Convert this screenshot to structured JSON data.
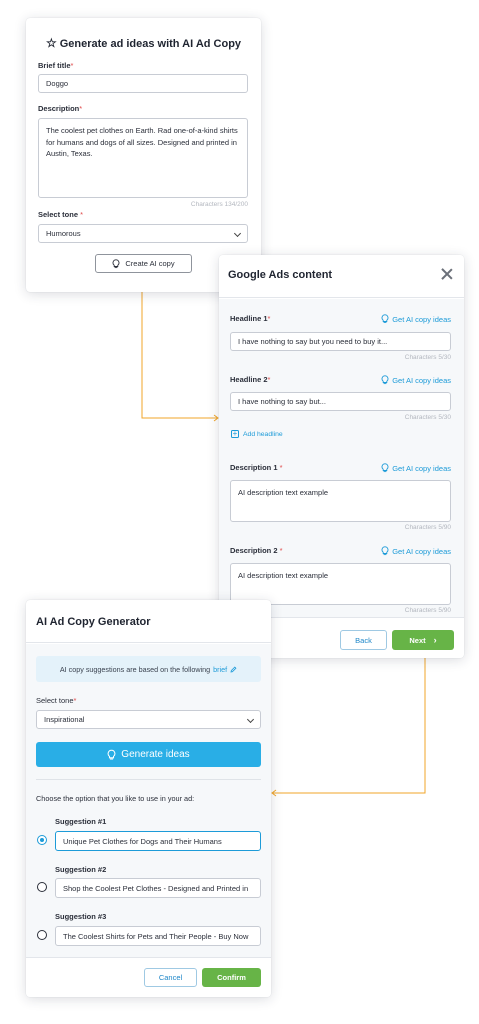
{
  "ad_brief": {
    "title": "Generate ad ideas with AI Ad Copy",
    "brief_title_label": "Brief title",
    "brief_title_value": "Doggo",
    "description_label": "Description",
    "description_value": "The coolest pet clothes on Earth. Rad one-of-a-kind shirts for humans and dogs of all sizes. Designed and printed in Austin, Texas.",
    "description_counter": "Characters 134/200",
    "tone_label": "Select tone",
    "tone_value": "Humorous",
    "create_button": "Create AI copy"
  },
  "google_ads": {
    "title": "Google Ads content",
    "ai_link": "Get AI copy ideas",
    "headline1_label": "Headline 1",
    "headline1_value": "I have nothing to say but you need to buy it...",
    "headline1_counter": "Characters 5/30",
    "headline2_label": "Headline 2",
    "headline2_value": "I have nothing to say but...",
    "headline2_counter": "Characters 5/30",
    "add_headline": "Add headline",
    "description1_label": "Description 1",
    "description1_value": "AI description text example",
    "description1_counter": "Characters 5/90",
    "description2_label": "Description 2",
    "description2_value": "AI description text example",
    "description2_counter": "Characters 5/90",
    "back_button": "Back",
    "next_button": "Next"
  },
  "generator": {
    "title": "AI Ad Copy Generator",
    "info_text": "AI copy suggestions are based on the following",
    "info_link": "brief",
    "tone_label": "Select tone",
    "tone_value": "Inspirational",
    "generate_button": "Generate ideas",
    "choose_text": "Choose the option that you like to use in your ad:",
    "suggestions": [
      {
        "label": "Suggestion #1",
        "value": "Unique Pet Clothes for Dogs and Their Humans",
        "selected": true
      },
      {
        "label": "Suggestion #2",
        "value": "Shop the Coolest Pet Clothes - Designed and Printed in",
        "selected": false
      },
      {
        "label": "Suggestion #3",
        "value": "The Coolest Shirts for Pets and Their People - Buy Now",
        "selected": false
      }
    ],
    "cancel_button": "Cancel",
    "confirm_button": "Confirm"
  },
  "colors": {
    "accent_blue": "#1d9bd8",
    "generate_blue": "#29aee6",
    "confirm_green": "#67b447",
    "connector_orange": "#f0a52a",
    "required_red": "#e04848"
  }
}
